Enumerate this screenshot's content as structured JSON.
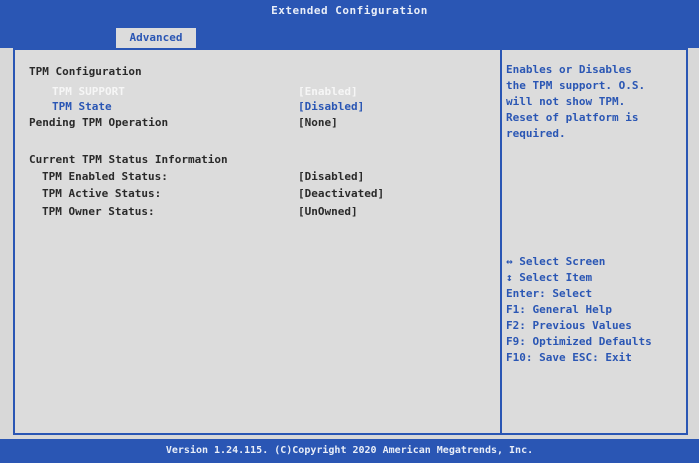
{
  "header": {
    "title": "Extended Configuration",
    "tab": "Advanced"
  },
  "settings": {
    "section_title": "TPM Configuration",
    "tpm_support": {
      "label": "TPM SUPPORT",
      "value": "[Enabled]"
    },
    "tpm_state": {
      "label": "TPM State",
      "value": "[Disabled]"
    },
    "pending_op": {
      "label": "Pending TPM Operation",
      "value": "[None]"
    },
    "status_title": "Current TPM Status Information",
    "enabled_status": {
      "label": "TPM Enabled Status:",
      "value": "[Disabled]"
    },
    "active_status": {
      "label": "TPM Active Status:",
      "value": "[Deactivated]"
    },
    "owner_status": {
      "label": "TPM Owner Status:",
      "value": "[UnOwned]"
    }
  },
  "help": {
    "text": "Enables or Disables\nthe TPM support. O.S.\nwill not show TPM.\nReset of platform is\nrequired.",
    "keys": [
      "↔  Select Screen",
      "↕  Select Item",
      "Enter: Select",
      "F1: General Help",
      "F2: Previous Values",
      "F9: Optimized Defaults",
      "F10: Save ESC: Exit"
    ]
  },
  "footer": {
    "text": "Version 1.24.115. (C)Copyright 2020 American Megatrends, Inc."
  },
  "colors": {
    "accent": "#2a56b4",
    "background": "#dcdcdc",
    "selected_text": "#f6f6f6"
  }
}
